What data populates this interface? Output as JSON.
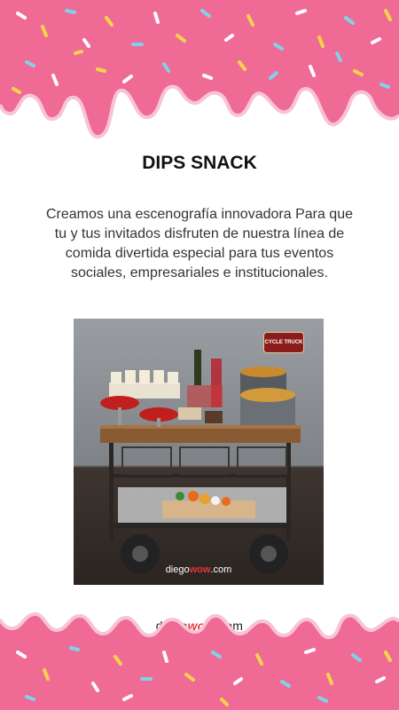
{
  "title": "DIPS SNACK",
  "description": "Creamos una escenografía innovadora  Para que tu y tus invitados disfruten de nuestra línea de comida divertida especial para tus eventos sociales, empresariales e institucionales.",
  "photo": {
    "badge_text": "CYCLE TRUCK",
    "brand_prefix": "diego",
    "brand_highlight": "wow",
    "brand_suffix": ".com"
  },
  "footer": {
    "brand_prefix": "diego",
    "brand_highlight": "wow",
    "brand_suffix": ".com"
  },
  "colors": {
    "frosting": "#f06a96",
    "frosting_dark": "#e04f81",
    "accent_red": "#e8353b"
  }
}
